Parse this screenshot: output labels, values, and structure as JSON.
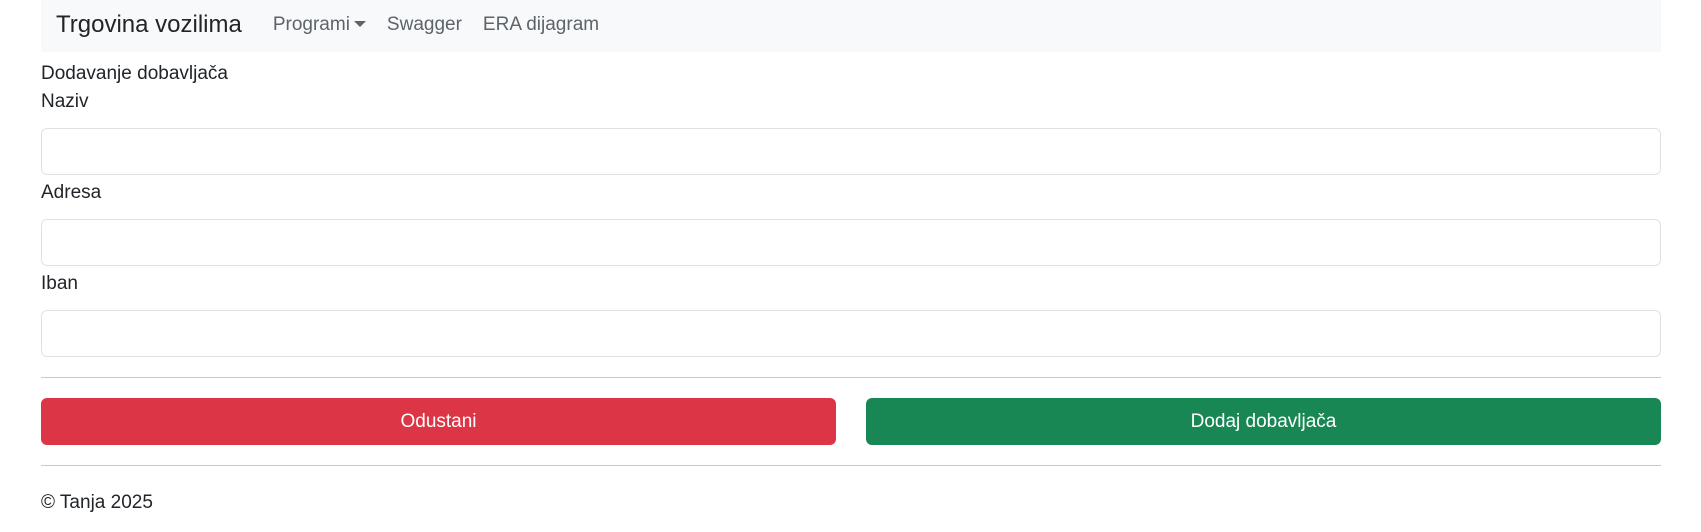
{
  "navbar": {
    "brand": "Trgovina vozilima",
    "items": [
      {
        "label": "Programi",
        "has_dropdown": true
      },
      {
        "label": "Swagger"
      },
      {
        "label": "ERA dijagram"
      }
    ]
  },
  "form": {
    "title": "Dodavanje dobavljača",
    "fields": [
      {
        "label": "Naziv",
        "value": ""
      },
      {
        "label": "Adresa",
        "value": ""
      },
      {
        "label": "Iban",
        "value": ""
      }
    ],
    "cancel_label": "Odustani",
    "submit_label": "Dodaj dobavljača"
  },
  "colors": {
    "danger": "#dc3545",
    "success": "#198754",
    "navbar_bg": "#f8f9fa"
  },
  "footer": {
    "text": "© Tanja 2025"
  }
}
